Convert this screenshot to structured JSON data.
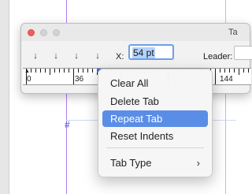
{
  "window": {
    "title": "Ta"
  },
  "toolbar": {
    "tab_types": [
      {
        "name": "left-tab",
        "glyph": "↓"
      },
      {
        "name": "center-tab",
        "glyph": "↓"
      },
      {
        "name": "right-tab",
        "glyph": "↓"
      },
      {
        "name": "align-tab",
        "glyph": "↓"
      }
    ],
    "x_label": "X:",
    "x_value": "54 pt",
    "leader_label": "Leader:",
    "leader_value": ""
  },
  "ruler": {
    "labels": [
      "0",
      "36",
      "144"
    ]
  },
  "context_menu": {
    "items": [
      {
        "label": "Clear All",
        "selected": false
      },
      {
        "label": "Delete Tab",
        "selected": false
      },
      {
        "label": "Repeat Tab",
        "selected": true
      },
      {
        "label": "Reset Indents",
        "selected": false
      },
      {
        "label": "Tab Type",
        "selected": false,
        "submenu": true
      }
    ],
    "submenu_glyph": "›"
  },
  "document": {
    "hash_glyph": "#"
  },
  "colors": {
    "accent": "#5a8ee6",
    "guide": "#b27cf0",
    "close_button": "#ef5c5a"
  }
}
